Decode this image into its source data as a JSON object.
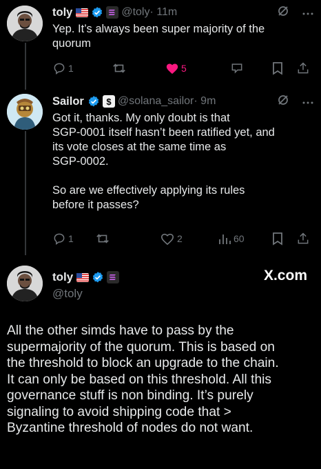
{
  "tweet1": {
    "name": "toly",
    "handle": "@toly",
    "time": "· 11m",
    "body_lines": [
      "Yep.  It’s always been super majority of the",
      "quorum"
    ],
    "replies": "1",
    "likes": "5",
    "like_color": "#f91880"
  },
  "tweet2": {
    "name": "Sailor",
    "handle": "@solana_sailor",
    "time": "· 9m",
    "body_lines": [
      "Got it, thanks. My only doubt is that",
      "SGP-0001 itself hasn’t been ratified yet, and",
      "its vote closes at the same time as",
      "SGP-0002.",
      "",
      "So are we effectively applying its rules",
      "before it passes?"
    ],
    "replies": "1",
    "likes": "2",
    "views": "60"
  },
  "tweet3": {
    "name": "toly",
    "handle": "@toly",
    "watermark": "X.com",
    "body_lines": [
      "All the other simds have to pass by the",
      "supermajority of the quorum.  This is based on",
      "the threshold to block an upgrade to the chain.",
      "It can only be based on this threshold.  All this",
      "governance stuff is non binding.  It’s purely",
      "signaling to avoid shipping code that >",
      "Byzantine threshold of nodes do not want."
    ]
  },
  "colors": {
    "verified": "#1d9bf0",
    "accent_pink": "#f91880",
    "muted": "#71767b"
  },
  "icons": [
    "verified-icon",
    "reply-icon",
    "retweet-icon",
    "like-icon",
    "views-icon",
    "bookmark-icon",
    "share-icon",
    "grok-icon",
    "more-icon",
    "flag-us-icon",
    "solana-badge-icon"
  ]
}
